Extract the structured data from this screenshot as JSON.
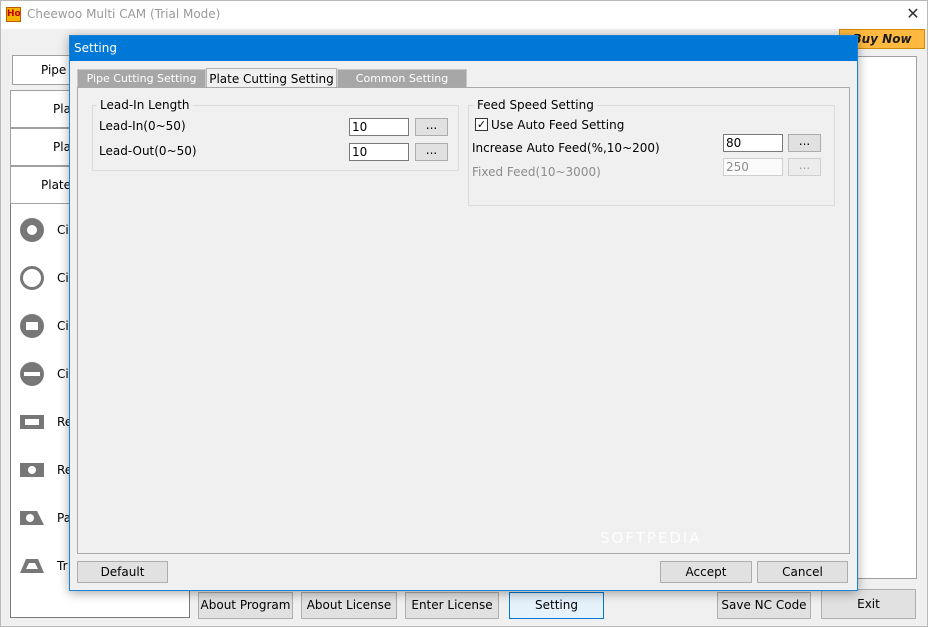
{
  "window": {
    "title": "Cheewoo Multi CAM (Trial Mode)",
    "buy_now": "Buy Now",
    "close": "✕",
    "app_icon": "Ho"
  },
  "left_panel": {
    "pipe_tab": "Pipe",
    "plate_items": [
      "Plat",
      "Plat",
      "Plate"
    ],
    "shapes": [
      {
        "label": "Cir",
        "icon": "circle-ring-icon"
      },
      {
        "label": "Cir",
        "icon": "circle-gap-icon"
      },
      {
        "label": "Cir",
        "icon": "circle-rect-hole-icon"
      },
      {
        "label": "Cir",
        "icon": "circle-slot-icon"
      },
      {
        "label": "Re",
        "icon": "rectangle-icon"
      },
      {
        "label": "Re",
        "icon": "rectangle-hole-icon"
      },
      {
        "label": "Pa",
        "icon": "parallelogram-icon"
      },
      {
        "label": "Tr",
        "icon": "trapezoid-icon"
      }
    ]
  },
  "bottom_buttons": {
    "about_program": "About Program",
    "about_license": "About License",
    "enter_license": "Enter License",
    "setting": "Setting",
    "save_nc": "Save NC Code",
    "exit": "Exit"
  },
  "dialog": {
    "title": "Setting",
    "tabs": [
      "Pipe Cutting Setting",
      "Plate Cutting Setting",
      "Common Setting"
    ],
    "active_tab": "Plate Cutting Setting",
    "lead_in": {
      "group_title": "Lead-In Length",
      "lead_in_label": "Lead-In(0~50)",
      "lead_in_value": "10",
      "lead_out_label": "Lead-Out(0~50)",
      "lead_out_value": "10"
    },
    "feed_speed": {
      "group_title": "Feed Speed Setting",
      "use_auto_label": "Use Auto Feed Setting",
      "use_auto_checked": "✓",
      "increase_label": "Increase Auto Feed(%,10~200)",
      "increase_value": "80",
      "fixed_label": "Fixed Feed(10~3000)",
      "fixed_value": "250"
    },
    "dots": "...",
    "buttons": {
      "default": "Default",
      "accept": "Accept",
      "cancel": "Cancel"
    }
  },
  "watermark": "SOFTPEDIA"
}
